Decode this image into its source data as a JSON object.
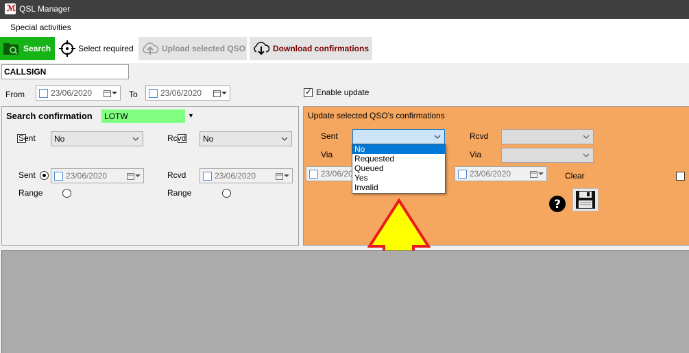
{
  "window": {
    "title": "QSL Manager"
  },
  "menu": {
    "items": [
      "Special activities"
    ]
  },
  "toolbar": {
    "search_label": "Search",
    "select_required_label": "Select required",
    "upload_label": "Upload selected QSO",
    "download_label": "Download confirmations"
  },
  "filters": {
    "callsign_value": "CALLSIGN",
    "from_label": "From",
    "from_date": "23/06/2020",
    "to_label": "To",
    "to_date": "23/06/2020",
    "enable_update_label": "Enable update",
    "enable_update_checked": true
  },
  "search_confirmation": {
    "title": "Search confirmation",
    "service_value": "LOTW",
    "sent_label": "Sent",
    "sent_value": "No",
    "rcvd_label": "Rcvd",
    "rcvd_value": "No",
    "sent_radio_label": "Sent",
    "sent_date": "23/06/2020",
    "rcvd_radio_label": "Rcvd",
    "rcvd_date": "23/06/2020",
    "range_label_1": "Range",
    "range_label_2": "Range"
  },
  "update_confirmations": {
    "title": "Update selected QSO's confirmations",
    "sent_label": "Sent",
    "sent_checked": true,
    "rcvd_label": "Rcvd",
    "via_label_1": "Via",
    "via_label_2": "Via",
    "left_date": "23/06/2020",
    "right_date": "23/06/2020",
    "clear_label": "Clear",
    "sent_options": [
      "No",
      "Requested",
      "Queued",
      "Yes",
      "Invalid"
    ],
    "sent_highlighted_option": "No"
  },
  "colors": {
    "search_button": "#17b417",
    "lotw_field": "#80ff80",
    "update_panel": "#f5a65f",
    "arrow_fill": "#ffff00",
    "arrow_stroke": "#e81c1c"
  }
}
